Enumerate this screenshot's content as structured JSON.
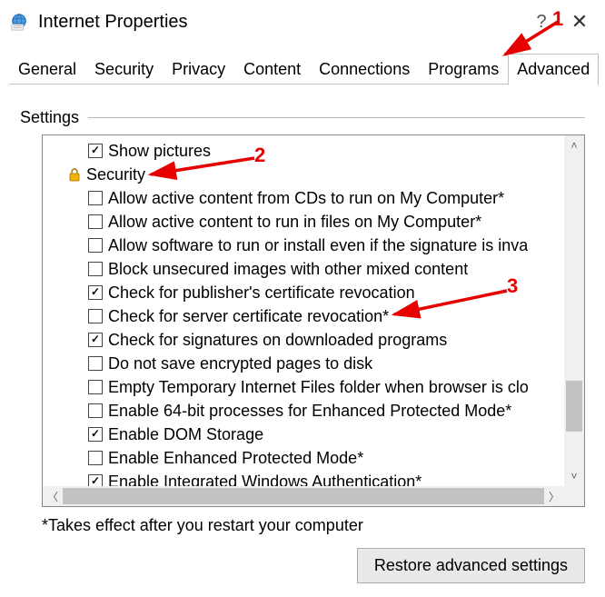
{
  "window": {
    "title": "Internet Properties",
    "help_glyph": "?",
    "close_glyph": "✕"
  },
  "tabs": [
    {
      "label": "General",
      "active": false
    },
    {
      "label": "Security",
      "active": false
    },
    {
      "label": "Privacy",
      "active": false
    },
    {
      "label": "Content",
      "active": false
    },
    {
      "label": "Connections",
      "active": false
    },
    {
      "label": "Programs",
      "active": false
    },
    {
      "label": "Advanced",
      "active": true
    }
  ],
  "group_label": "Settings",
  "section_header": {
    "icon": "lock",
    "label": "Security"
  },
  "items": [
    {
      "kind": "check",
      "checked": true,
      "label": "Show pictures"
    },
    {
      "kind": "header"
    },
    {
      "kind": "check",
      "checked": false,
      "label": "Allow active content from CDs to run on My Computer*"
    },
    {
      "kind": "check",
      "checked": false,
      "label": "Allow active content to run in files on My Computer*"
    },
    {
      "kind": "check",
      "checked": false,
      "label": "Allow software to run or install even if the signature is inva"
    },
    {
      "kind": "check",
      "checked": false,
      "label": "Block unsecured images with other mixed content"
    },
    {
      "kind": "check",
      "checked": true,
      "label": "Check for publisher's certificate revocation"
    },
    {
      "kind": "check",
      "checked": false,
      "label": "Check for server certificate revocation*"
    },
    {
      "kind": "check",
      "checked": true,
      "label": "Check for signatures on downloaded programs"
    },
    {
      "kind": "check",
      "checked": false,
      "label": "Do not save encrypted pages to disk"
    },
    {
      "kind": "check",
      "checked": false,
      "label": "Empty Temporary Internet Files folder when browser is clo"
    },
    {
      "kind": "check",
      "checked": false,
      "label": "Enable 64-bit processes for Enhanced Protected Mode*"
    },
    {
      "kind": "check",
      "checked": true,
      "label": "Enable DOM Storage"
    },
    {
      "kind": "check",
      "checked": false,
      "label": "Enable Enhanced Protected Mode*"
    },
    {
      "kind": "check",
      "checked": true,
      "label": "Enable Integrated Windows Authentication*"
    }
  ],
  "footnote": "*Takes effect after you restart your computer",
  "restore_label": "Restore advanced settings",
  "annotations": {
    "num1": "1",
    "num2": "2",
    "num3": "3"
  }
}
